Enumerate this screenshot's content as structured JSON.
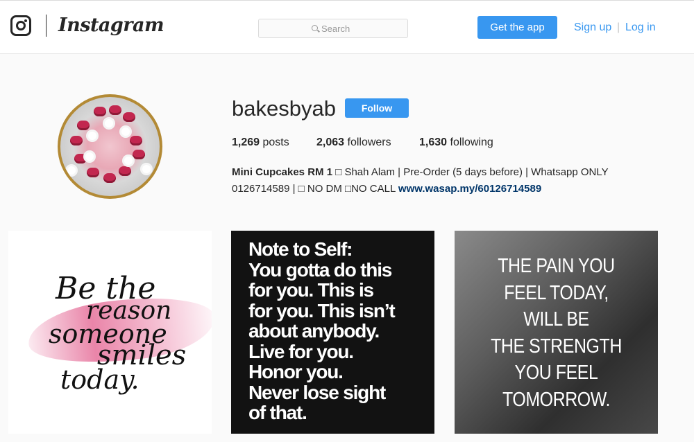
{
  "header": {
    "brand": "Instagram",
    "search_placeholder": "Search",
    "get_app_label": "Get the app",
    "signup_label": "Sign up",
    "separator": "|",
    "login_label": "Log in"
  },
  "profile": {
    "username": "bakesbyab",
    "follow_label": "Follow",
    "stats": {
      "posts_count": "1,269",
      "posts_label": "posts",
      "followers_count": "2,063",
      "followers_label": "followers",
      "following_count": "1,630",
      "following_label": "following"
    },
    "bio": {
      "name": "Mini Cupcakes RM 1",
      "line1_rest": " □ Shah Alam | Pre-Order (5 days before) | Whatsapp ONLY",
      "line2": "0126714589 | □ NO DM □NO CALL ",
      "link": "www.wasap.my/60126714589"
    }
  },
  "posts": [
    {
      "lines": [
        "Be the",
        "reason",
        "someone",
        "smiles",
        "today."
      ]
    },
    {
      "lines": [
        "Note to Self:",
        "You gotta do this",
        "for you. This is",
        "for you. This isn’t",
        "about anybody.",
        "Live for you.",
        "Honor you.",
        "Never lose sight",
        "of that."
      ]
    },
    {
      "lines": [
        "THE PAIN YOU",
        "FEEL TODAY,",
        "WILL BE",
        "THE STRENGTH",
        "YOU FEEL",
        "TOMORROW."
      ]
    }
  ],
  "colors": {
    "accent": "#3897f0",
    "link": "#003569",
    "background": "#fafafa",
    "text": "#262626"
  }
}
